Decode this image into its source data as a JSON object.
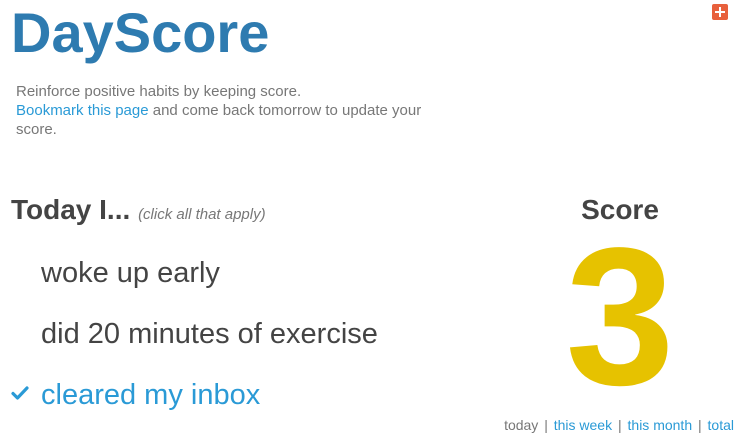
{
  "app": {
    "title": "DayScore"
  },
  "intro": {
    "line1": "Reinforce positive habits by keeping score.",
    "bookmark_link": "Bookmark this page",
    "line2_rest": " and come back tomorrow to update your score."
  },
  "today": {
    "heading": "Today I...",
    "hint": "(click all that apply)"
  },
  "habits": [
    {
      "label": "woke up early",
      "checked": false
    },
    {
      "label": "did 20 minutes of exercise",
      "checked": false
    },
    {
      "label": "cleared my inbox",
      "checked": true
    }
  ],
  "score": {
    "heading": "Score",
    "value": "3"
  },
  "periods": {
    "today": "today",
    "this_week": "this week",
    "this_month": "this month",
    "total": "total",
    "separator": "|"
  },
  "colors": {
    "title": "#2e7bb0",
    "link": "#2a9ad6",
    "score": "#e6c200",
    "plus_button": "#e8603c"
  },
  "icons": {
    "plus_button": "plus-icon",
    "check": "check-icon"
  }
}
